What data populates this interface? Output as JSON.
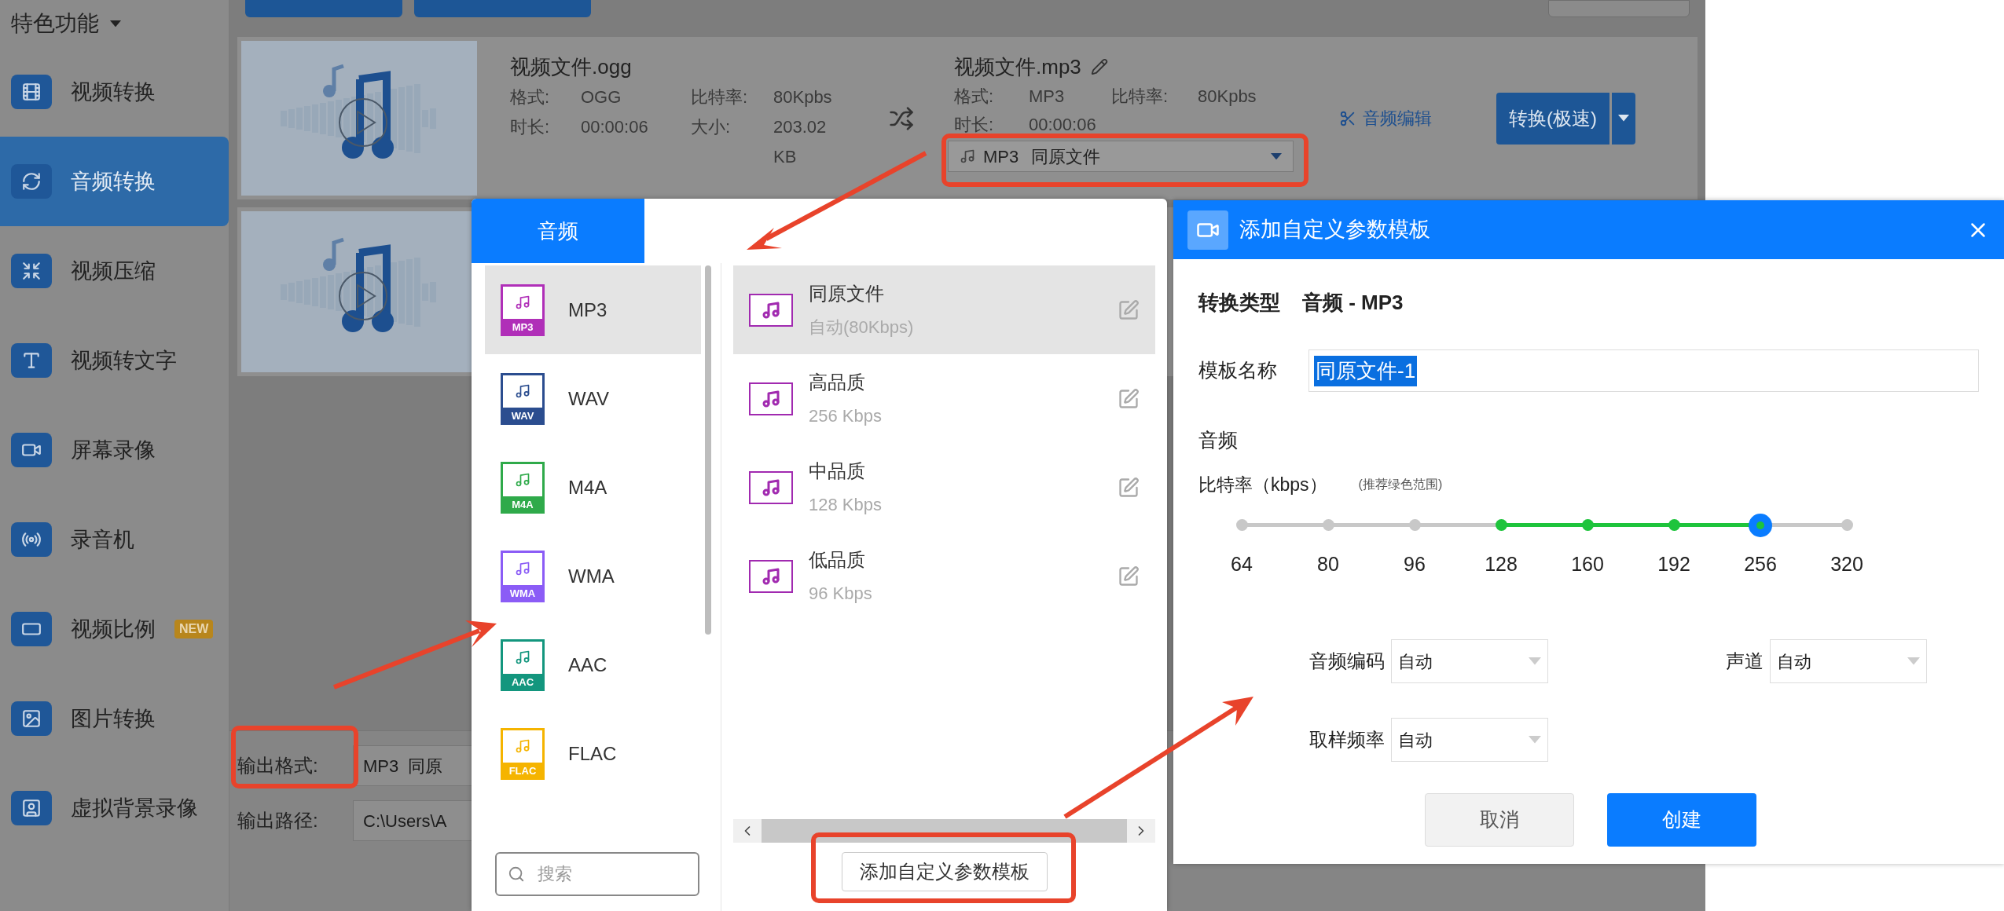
{
  "sidebar": {
    "header": "特色功能",
    "items": [
      {
        "label": "视频转换",
        "selected": false
      },
      {
        "label": "音频转换",
        "selected": true
      },
      {
        "label": "视频压缩",
        "selected": false
      },
      {
        "label": "视频转文字",
        "selected": false
      },
      {
        "label": "屏幕录像",
        "selected": false
      },
      {
        "label": "录音机",
        "selected": false
      },
      {
        "label": "视频比例",
        "selected": false,
        "badge": "NEW"
      },
      {
        "label": "图片转换",
        "selected": false
      },
      {
        "label": "虚拟背景录像",
        "selected": false
      }
    ]
  },
  "files": [
    {
      "kind": "full",
      "source": {
        "name": "视频文件.ogg",
        "format_label": "格式:",
        "format": "OGG",
        "bitrate_label": "比特率:",
        "bitrate": "80Kpbs",
        "duration_label": "时长:",
        "duration": "00:00:06",
        "size_label": "大小:",
        "size": "203.02 KB"
      },
      "target": {
        "name": "视频文件.mp3",
        "format_label": "格式:",
        "format": "MP3",
        "bitrate_label": "比特率:",
        "bitrate": "80Kpbs",
        "duration_label": "时长:",
        "duration": "00:00:06",
        "preset_format": "MP3",
        "preset_name": "同原文件"
      },
      "edit_link": "音频编辑",
      "convert_button": "转换(极速)"
    },
    {
      "kind": "thumbnail_only"
    }
  ],
  "output_format": {
    "label": "输出格式:",
    "value": "MP3  同原"
  },
  "output_path": {
    "label": "输出路径:",
    "value": "C:\\Users\\A"
  },
  "format_picker": {
    "tabs": [
      {
        "label": "音频",
        "selected": true
      }
    ],
    "formats": [
      {
        "name": "MP3",
        "badge": "MP3",
        "color": "#b02fb8",
        "selected": true
      },
      {
        "name": "WAV",
        "badge": "WAV",
        "color": "#2b4d8f",
        "selected": false
      },
      {
        "name": "M4A",
        "badge": "M4A",
        "color": "#2faa4a",
        "selected": false
      },
      {
        "name": "WMA",
        "badge": "WMA",
        "color": "#8b5cf6",
        "selected": false
      },
      {
        "name": "AAC",
        "badge": "AAC",
        "color": "#13967e",
        "selected": false
      },
      {
        "name": "FLAC",
        "badge": "FLAC",
        "color": "#f5b400",
        "selected": false
      }
    ],
    "search_placeholder": "搜索",
    "presets": [
      {
        "name": "同原文件",
        "detail": "自动(80Kbps)",
        "selected": true
      },
      {
        "name": "高品质",
        "detail": "256 Kbps",
        "selected": false
      },
      {
        "name": "中品质",
        "detail": "128 Kbps",
        "selected": false
      },
      {
        "name": "低品质",
        "detail": "96 Kbps",
        "selected": false
      }
    ],
    "add_button": "添加自定义参数模板"
  },
  "template_dialog": {
    "title": "添加自定义参数模板",
    "type_label": "转换类型",
    "type_value": "音频 - MP3",
    "name_label": "模板名称",
    "name_value": "同原文件-1",
    "section": "音频",
    "bitrate_label": "比特率（kbps）",
    "bitrate_hint": "(推荐绿色范围)",
    "bitrate_ticks": [
      {
        "label": "64",
        "recommended": false
      },
      {
        "label": "80",
        "recommended": false
      },
      {
        "label": "96",
        "recommended": false
      },
      {
        "label": "128",
        "recommended": true
      },
      {
        "label": "160",
        "recommended": true
      },
      {
        "label": "192",
        "recommended": true
      },
      {
        "label": "256",
        "recommended": true
      },
      {
        "label": "320",
        "recommended": false
      }
    ],
    "bitrate_slider": {
      "level": 0.857
    },
    "selects": [
      {
        "label": "音频编码",
        "value": "自动"
      },
      {
        "label": "声道",
        "value": "自动"
      },
      {
        "label": "取样频率",
        "value": "自动"
      }
    ],
    "cancel_button": "取消",
    "create_button": "创建"
  }
}
